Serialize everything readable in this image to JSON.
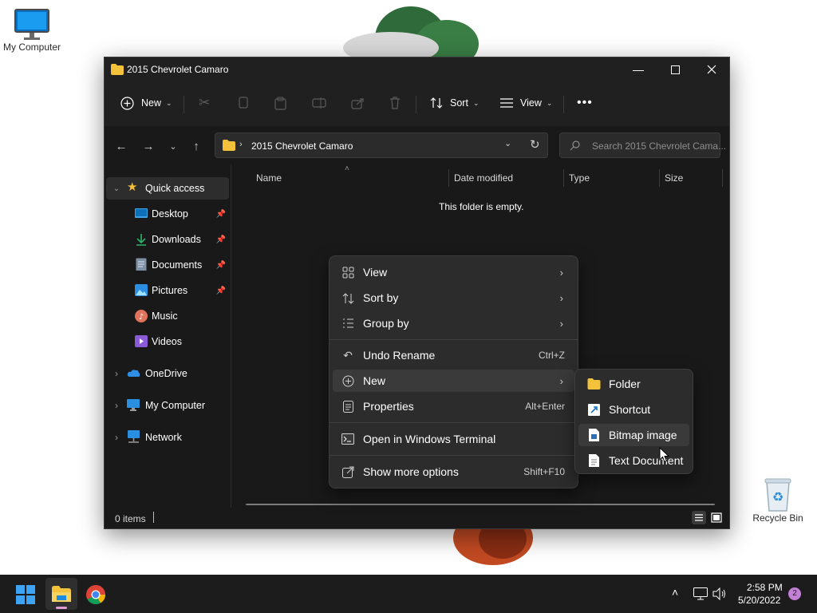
{
  "desktop": {
    "my_computer_label": "My Computer",
    "recycle_bin_label": "Recycle Bin"
  },
  "window": {
    "title": "2015 Chevrolet Camaro",
    "toolbar": {
      "new_label": "New",
      "sort_label": "Sort",
      "view_label": "View"
    },
    "address": {
      "path": "2015 Chevrolet Camaro"
    },
    "search": {
      "placeholder": "Search 2015 Chevrolet Cama..."
    },
    "sidebar": {
      "quick_access": "Quick access",
      "items": [
        {
          "label": "Desktop",
          "pinned": true
        },
        {
          "label": "Downloads",
          "pinned": true
        },
        {
          "label": "Documents",
          "pinned": true
        },
        {
          "label": "Pictures",
          "pinned": true
        },
        {
          "label": "Music",
          "pinned": false
        },
        {
          "label": "Videos",
          "pinned": false
        }
      ],
      "onedrive": "OneDrive",
      "my_computer": "My Computer",
      "network": "Network"
    },
    "columns": {
      "name": "Name",
      "date_modified": "Date modified",
      "type": "Type",
      "size": "Size"
    },
    "empty_message": "This folder is empty.",
    "status": {
      "items": "0 items"
    }
  },
  "context_menu": {
    "view": "View",
    "sort_by": "Sort by",
    "group_by": "Group by",
    "undo_rename": "Undo Rename",
    "undo_shortcut": "Ctrl+Z",
    "new": "New",
    "properties": "Properties",
    "properties_shortcut": "Alt+Enter",
    "open_terminal": "Open in Windows Terminal",
    "show_more": "Show more options",
    "show_more_shortcut": "Shift+F10"
  },
  "new_submenu": {
    "folder": "Folder",
    "shortcut": "Shortcut",
    "bitmap": "Bitmap image",
    "text_document": "Text Document"
  },
  "taskbar": {
    "time": "2:58 PM",
    "date": "5/20/2022",
    "notification_count": "2"
  },
  "colors": {
    "window_bg": "#191919",
    "menu_bg": "#2c2c2c",
    "accent": "#0078d4",
    "folder_yellow": "#f3c13a",
    "taskbar_bg": "#1c1c1c"
  }
}
